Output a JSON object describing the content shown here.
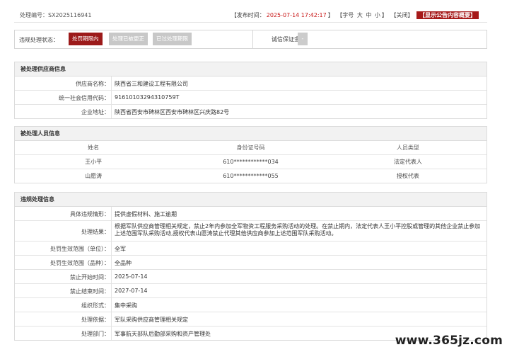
{
  "header": {
    "case_no_label": "处理编号：",
    "case_no": "SX2025116941",
    "publish_label": "【发布时间：",
    "publish_time": "2025-07-14 17:42:17",
    "publish_end": "】",
    "font_label": "【字号",
    "font_large": "大",
    "font_mid": "中",
    "font_small": "小",
    "font_end": "】",
    "close_label": "【关闭】",
    "summary_badge": "【显示公告内容概要】"
  },
  "status_bar": {
    "label": "违规处理状态：",
    "buttons": [
      "处罚期限内",
      "处理已被更正",
      "已过处理期限"
    ],
    "deposit_label": "诚信保证金：",
    "deposit_value": "-"
  },
  "supplier": {
    "title": "被处理供应商信息",
    "rows": [
      {
        "k": "供应商名称：",
        "v": "陕西省三和建设工程有限公司"
      },
      {
        "k": "统一社会信用代码：",
        "v": "91610103294310759T"
      },
      {
        "k": "企业地址：",
        "v": "陕西省西安市碑林区西安市碑林区兴庆路82号"
      }
    ]
  },
  "persons": {
    "title": "被处理人员信息",
    "headers": [
      "姓名",
      "身份证号码",
      "人员类型"
    ],
    "rows": [
      [
        "王小平",
        "610************034",
        "法定代表人"
      ],
      [
        "山愿涛",
        "610************055",
        "授权代表"
      ]
    ]
  },
  "violation": {
    "title": "违规处理信息",
    "rows": [
      {
        "k": "具体违规情形：",
        "v": "提供虚假材料、施工逾期"
      },
      {
        "k": "处理结果：",
        "v": "根据军队供应商管理相关规定，禁止2年内参加全军物资工程服务采购活动的处理。在禁止期内，法定代表人王小平控股或管理的其他企业禁止参加上述范围军队采购活动,授权代表山愿涛禁止代理其他供应商参加上述范围军队采购活动。"
      },
      {
        "k": "处罚生效范围（单位）：",
        "v": "全军"
      },
      {
        "k": "处罚生效范围（品种）：",
        "v": "全品种"
      },
      {
        "k": "禁止开始时间：",
        "v": "2025-07-14"
      },
      {
        "k": "禁止结束时间：",
        "v": "2027-07-14"
      },
      {
        "k": "组织形式：",
        "v": "集中采购"
      },
      {
        "k": "处理依据：",
        "v": "军队采购供应商管理相关规定"
      },
      {
        "k": "处理部门：",
        "v": "军事航天部队后勤部采购和资产管理处"
      }
    ]
  },
  "watermark": "www.365jz.com"
}
